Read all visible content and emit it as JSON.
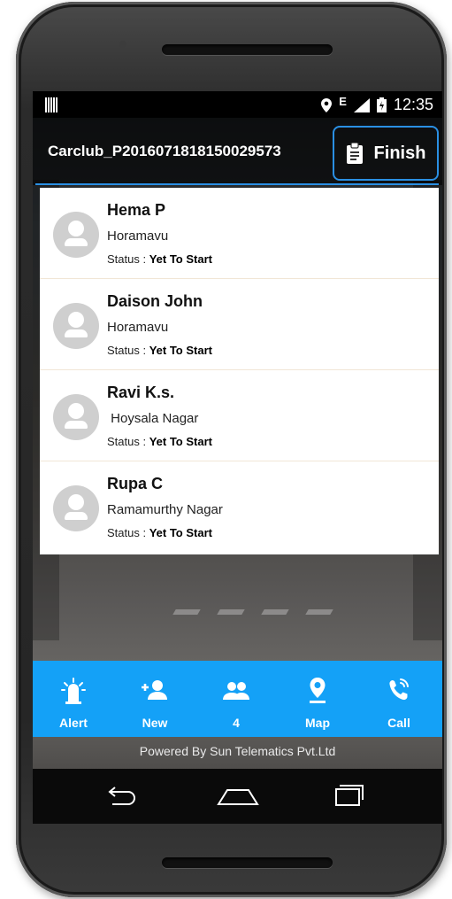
{
  "status_bar": {
    "time": "12:35",
    "network": "E"
  },
  "header": {
    "title": "Carclub_P2016071818150029573",
    "finish_label": "Finish"
  },
  "passengers": [
    {
      "name": "Hema P",
      "location": "Horamavu",
      "status_label": "Status :",
      "status_value": "Yet To Start"
    },
    {
      "name": "Daison John",
      "location": "Horamavu",
      "status_label": "Status :",
      "status_value": "Yet To Start"
    },
    {
      "name": "Ravi K.s.",
      "location": " Hoysala Nagar",
      "status_label": "Status :",
      "status_value": "Yet To Start"
    },
    {
      "name": "Rupa C",
      "location": "Ramamurthy Nagar",
      "status_label": "Status :",
      "status_value": "Yet To Start"
    }
  ],
  "tabs": [
    {
      "label": "Alert",
      "icon": "siren-icon"
    },
    {
      "label": "New",
      "icon": "add-person-icon"
    },
    {
      "label": "4",
      "icon": "group-icon"
    },
    {
      "label": "Map",
      "icon": "map-pin-icon"
    },
    {
      "label": "Call",
      "icon": "phone-call-icon"
    }
  ],
  "footer": {
    "powered_by": "Powered By Sun Telematics Pvt.Ltd"
  },
  "colors": {
    "accent": "#14a1f7",
    "title_border": "#2a8fe3"
  }
}
